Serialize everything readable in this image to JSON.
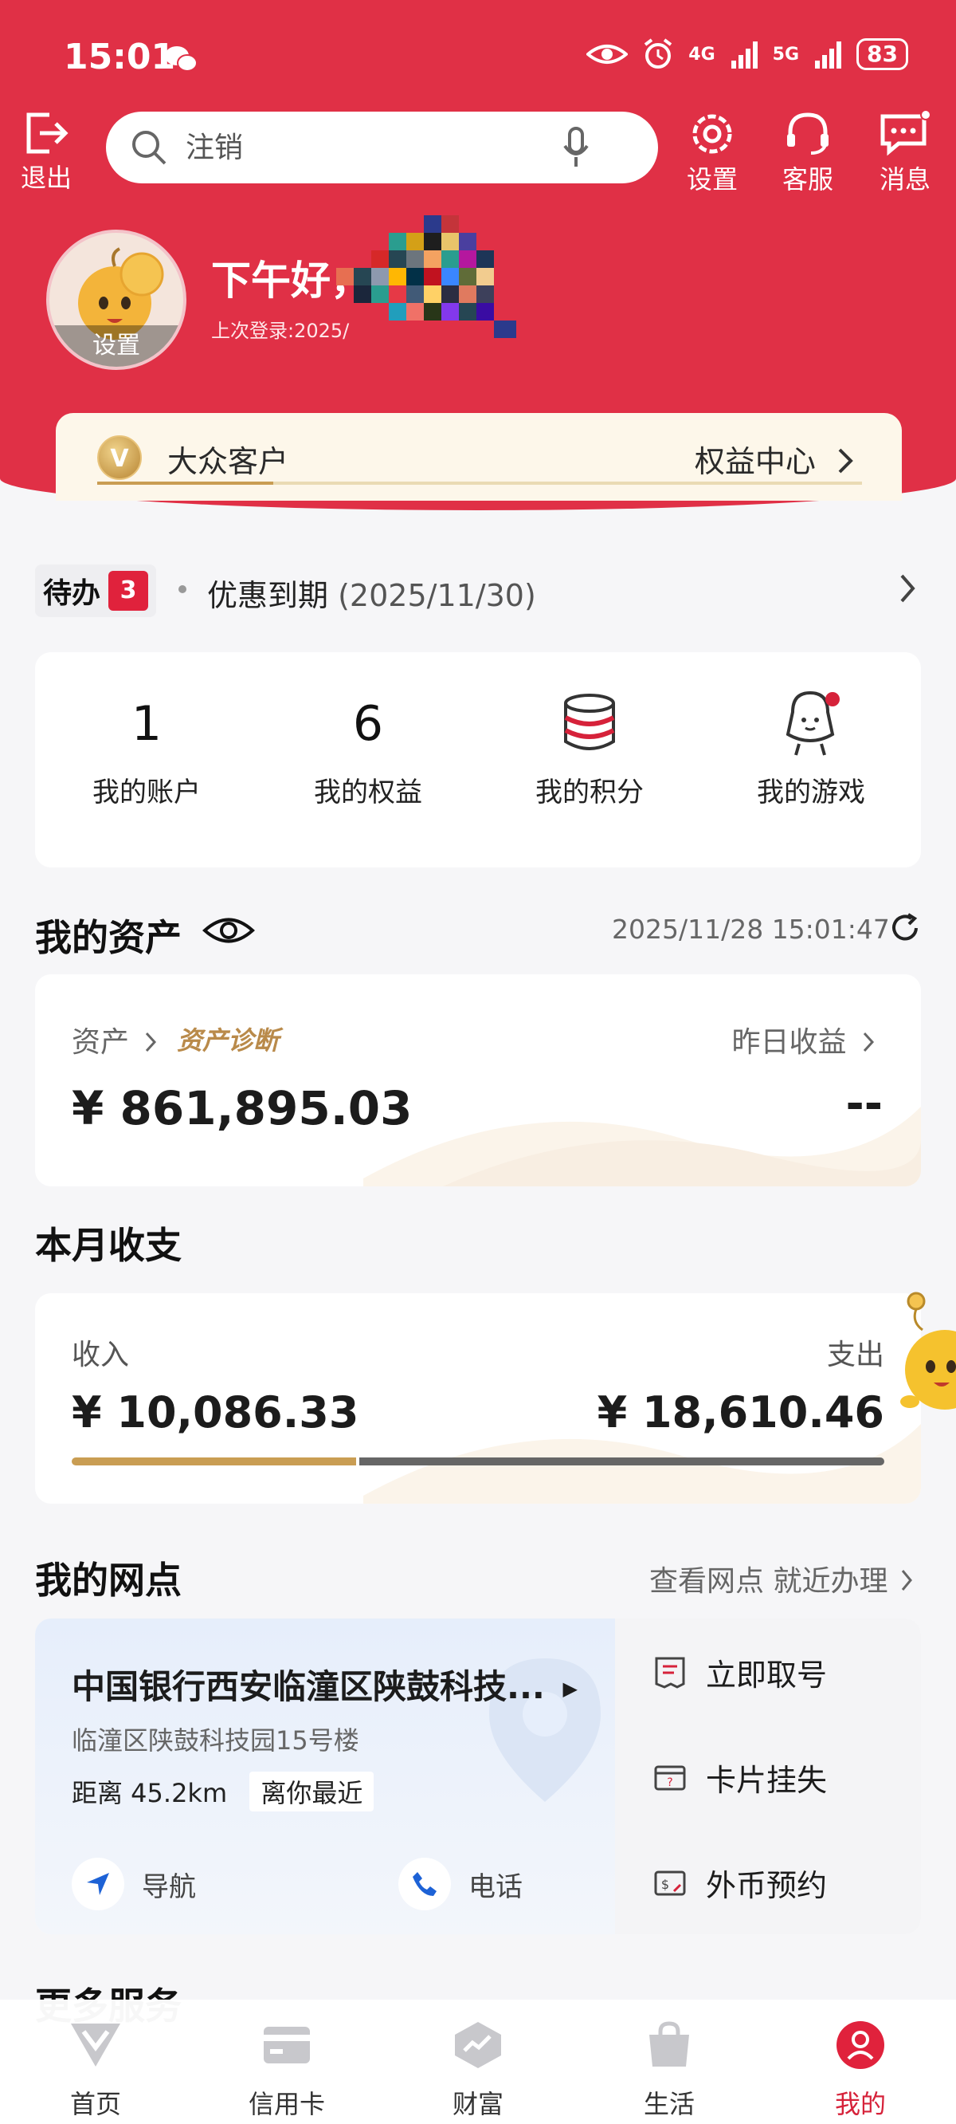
{
  "status_bar": {
    "time": "15:01",
    "network_1": "4G",
    "network_2": "5G",
    "battery": "83"
  },
  "header": {
    "logout_label": "退出",
    "search_placeholder": "注销",
    "settings_label": "设置",
    "service_label": "客服",
    "message_label": "消息"
  },
  "profile": {
    "avatar_label": "设置",
    "greeting": "下午好，",
    "last_login": "上次登录:2025/"
  },
  "membership": {
    "badge": "V",
    "level": "大众客户",
    "link": "权益中心",
    "progress": 0.23
  },
  "todo": {
    "tag": "待办",
    "count": "3",
    "text": "优惠到期",
    "date": "(2025/11/30)"
  },
  "quick_stats": [
    {
      "value": "1",
      "label": "我的账户"
    },
    {
      "value": "6",
      "label": "我的权益"
    },
    {
      "label": "我的积分"
    },
    {
      "label": "我的游戏"
    }
  ],
  "assets": {
    "title": "我的资产",
    "timestamp": "2025/11/28 15:01:47",
    "assets_label": "资产",
    "diagnosis_label": "资产诊断",
    "yesterday_label": "昨日收益",
    "amount": "¥ 861,895.03",
    "yesterday_value": "--"
  },
  "monthly": {
    "title": "本月收支",
    "income_label": "收入",
    "expense_label": "支出",
    "income": "¥ 10,086.33",
    "expense": "¥ 18,610.46",
    "income_share": 0.35
  },
  "branch": {
    "title": "我的网点",
    "link": "查看网点 就近办理",
    "name": "中国银行西安临潼区陕鼓科技...",
    "address": "临潼区陕鼓科技园15号楼",
    "distance": "距离 45.2km",
    "nearest_tag": "离你最近",
    "nav_label": "导航",
    "phone_label": "电话",
    "services": [
      "立即取号",
      "卡片挂失",
      "外币预约"
    ]
  },
  "more_services": {
    "title": "更多服务"
  },
  "tabbar": {
    "items": [
      "首页",
      "信用卡",
      "财富",
      "生活",
      "我的"
    ],
    "active_index": 4
  },
  "colors": {
    "brand_red": "#e03046",
    "gold": "#c99d53",
    "expense_bar": "#666666"
  }
}
